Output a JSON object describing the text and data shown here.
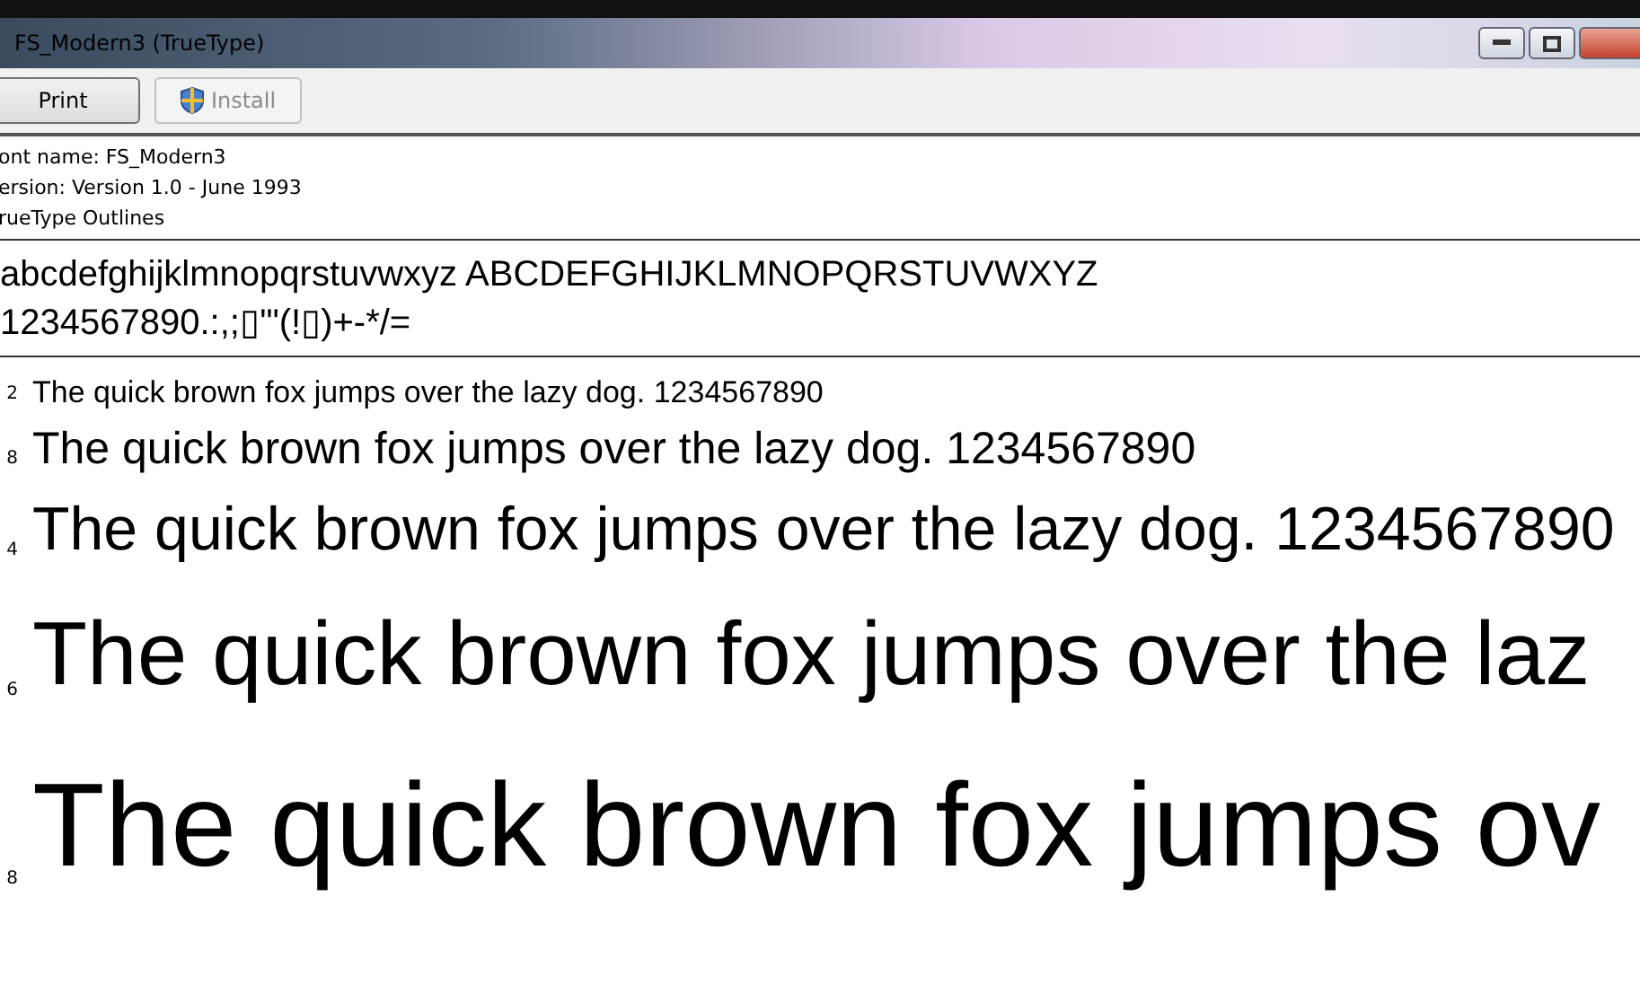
{
  "window": {
    "title": "FS_Modern3 (TrueType)"
  },
  "toolbar": {
    "buttons": [
      {
        "label": "Print",
        "disabled": false
      },
      {
        "label": "Install",
        "disabled": true
      }
    ]
  },
  "info": [
    "ont name: FS_Modern3",
    "ersion: Version 1.0 - June 1993",
    "rueType Outlines"
  ],
  "charset": [
    "abcdefghijklmnopqrstuvwxyz ABCDEFGHIJKLMNOPQRSTUVWXYZ",
    "1234567890.:,;▯'\"(!▯)+-*/="
  ],
  "samples": [
    {
      "size": "2",
      "text": "The quick brown fox jumps over the lazy dog. 1234567890",
      "kind": "xs"
    },
    {
      "size": "8",
      "text": "The quick brown fox jumps over the lazy dog. 1234567890",
      "kind": "s"
    },
    {
      "size": "4",
      "text": "The quick brown fox jumps over the lazy dog. 1234567890",
      "kind": "m"
    },
    {
      "size": "6",
      "text": "The quick brown fox jumps over the laz",
      "kind": "l"
    },
    {
      "size": "8",
      "text": "The quick brown fox jumps ov",
      "kind": "xl"
    }
  ]
}
